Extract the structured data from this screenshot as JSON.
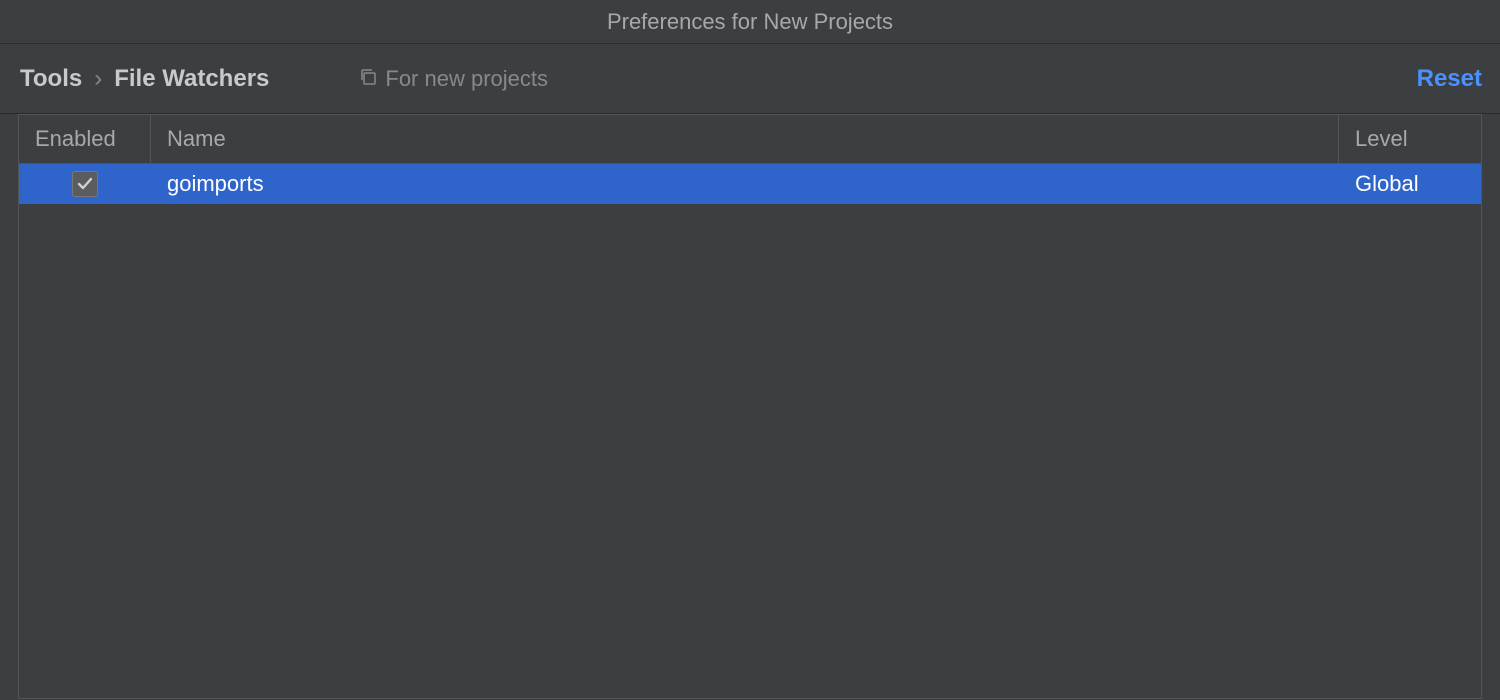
{
  "window": {
    "title": "Preferences for New Projects"
  },
  "breadcrumb": {
    "root": "Tools",
    "separator": "›",
    "leaf": "File Watchers"
  },
  "scope": {
    "label": "For new projects"
  },
  "actions": {
    "reset": "Reset"
  },
  "table": {
    "headers": {
      "enabled": "Enabled",
      "name": "Name",
      "level": "Level"
    },
    "rows": [
      {
        "enabled": true,
        "name": "goimports",
        "level": "Global",
        "selected": true
      }
    ]
  },
  "colors": {
    "selection": "#2f65ca",
    "link": "#4a90ff"
  }
}
